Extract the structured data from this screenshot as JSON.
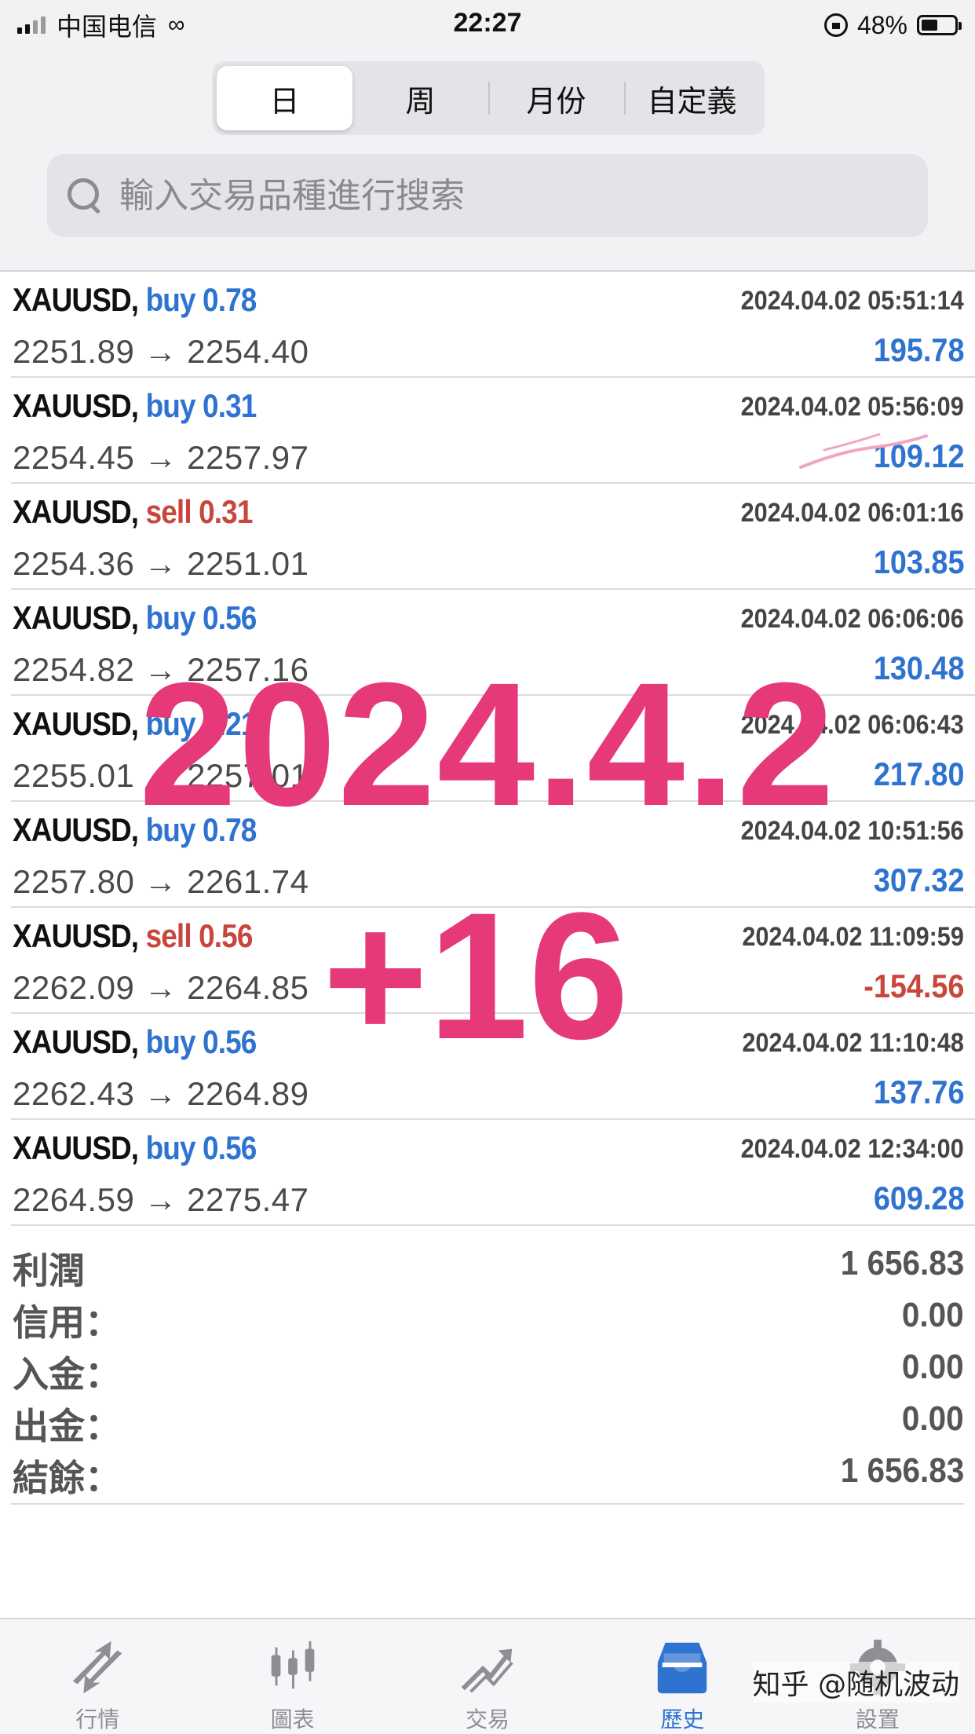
{
  "status_bar": {
    "carrier": "中国电信",
    "time": "22:27",
    "battery": "48%"
  },
  "period_tabs": [
    "日",
    "周",
    "月份",
    "自定義"
  ],
  "search": {
    "placeholder": "輸入交易品種進行搜索"
  },
  "trades": [
    {
      "symbol": "XAUUSD,",
      "side": "buy",
      "volume": "0.78",
      "prices": "2251.89 → 2254.40",
      "datetime": "2024.04.02 05:51:14",
      "profit": "195.78"
    },
    {
      "symbol": "XAUUSD,",
      "side": "buy",
      "volume": "0.31",
      "prices": "2254.45 → 2257.97",
      "datetime": "2024.04.02 05:56:09",
      "profit": "109.12"
    },
    {
      "symbol": "XAUUSD,",
      "side": "sell",
      "volume": "0.31",
      "prices": "2254.36 → 2251.01",
      "datetime": "2024.04.02 06:01:16",
      "profit": "103.85"
    },
    {
      "symbol": "XAUUSD,",
      "side": "buy",
      "volume": "0.56",
      "prices": "2254.82 → 2257.16",
      "datetime": "2024.04.02 06:06:06",
      "profit": "130.48"
    },
    {
      "symbol": "XAUUSD,",
      "side": "buy",
      "volume": "1.21",
      "prices": "2255.01 → 2257.01",
      "datetime": "2024.04.02 06:06:43",
      "profit": "217.80"
    },
    {
      "symbol": "XAUUSD,",
      "side": "buy",
      "volume": "0.78",
      "prices": "2257.80 → 2261.74",
      "datetime": "2024.04.02 10:51:56",
      "profit": "307.32"
    },
    {
      "symbol": "XAUUSD,",
      "side": "sell",
      "volume": "0.56",
      "prices": "2262.09 → 2264.85",
      "datetime": "2024.04.02 11:09:59",
      "profit": "-154.56"
    },
    {
      "symbol": "XAUUSD,",
      "side": "buy",
      "volume": "0.56",
      "prices": "2262.43 → 2264.89",
      "datetime": "2024.04.02 11:10:48",
      "profit": "137.76"
    },
    {
      "symbol": "XAUUSD,",
      "side": "buy",
      "volume": "0.56",
      "prices": "2264.59 → 2275.47",
      "datetime": "2024.04.02 12:34:00",
      "profit": "609.28"
    }
  ],
  "summary": [
    {
      "label": "利潤",
      "value": "1 656.83"
    },
    {
      "label": "信用：",
      "value": "0.00"
    },
    {
      "label": "入金：",
      "value": "0.00"
    },
    {
      "label": "出金：",
      "value": "0.00"
    },
    {
      "label": "結餘：",
      "value": "1 656.83"
    }
  ],
  "overlay": {
    "date": "2024.4.2",
    "delta": "+16",
    "color": "#e5397a"
  },
  "tabbar": [
    {
      "label": "行情",
      "icon": "quotes-icon"
    },
    {
      "label": "圖表",
      "icon": "chart-icon"
    },
    {
      "label": "交易",
      "icon": "trade-icon"
    },
    {
      "label": "歷史",
      "icon": "history-icon",
      "active": true
    },
    {
      "label": "設置",
      "icon": "settings-icon"
    }
  ],
  "watermark": "知乎 @随机波动",
  "colors": {
    "buy": "#2f73d0",
    "sell": "#c8473c",
    "active_tab": "#2f73d0"
  }
}
